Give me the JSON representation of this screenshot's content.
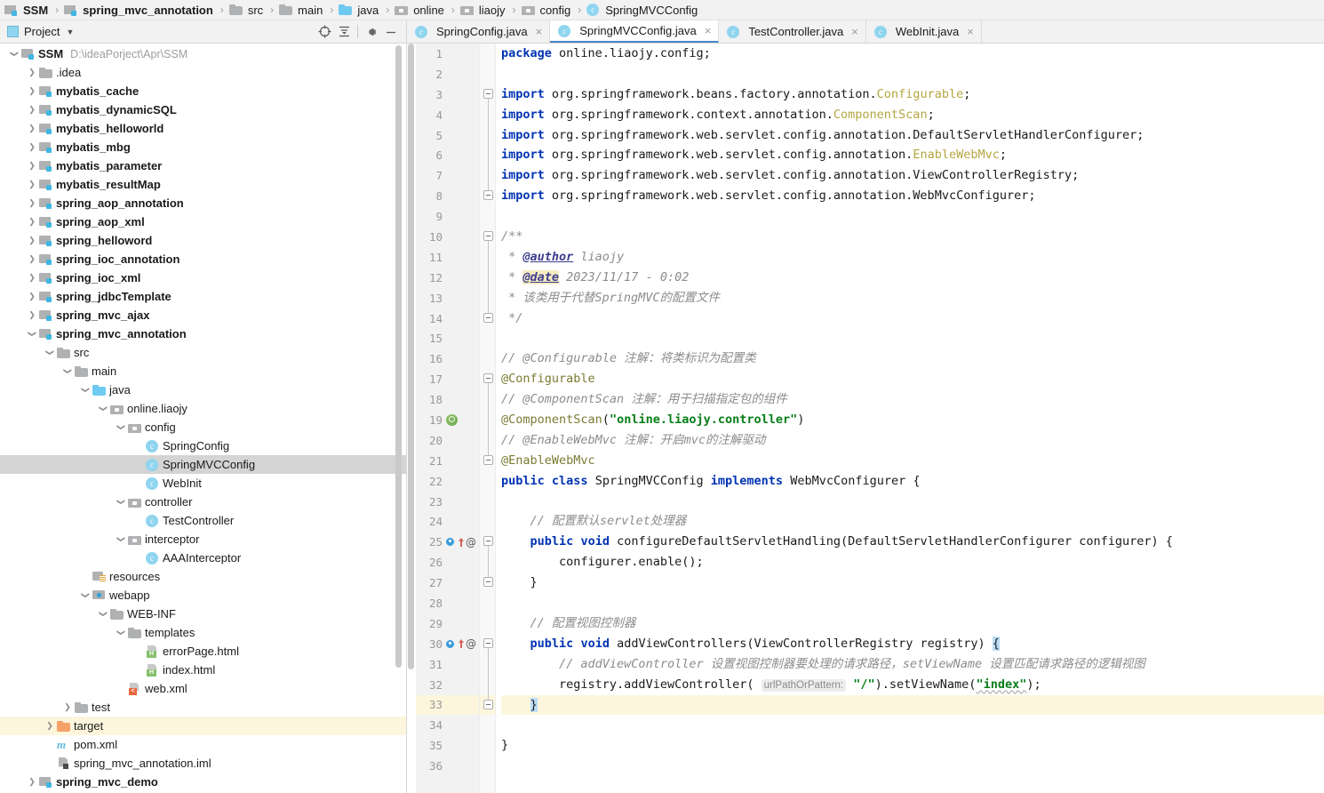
{
  "breadcrumb": {
    "items": [
      {
        "label": "SSM",
        "icon": "project-icon",
        "bold": true,
        "type": "project"
      },
      {
        "label": "spring_mvc_annotation",
        "icon": "module-icon",
        "bold": true,
        "type": "module"
      },
      {
        "label": "src",
        "icon": "folder-icon",
        "bold": false,
        "type": "folder"
      },
      {
        "label": "main",
        "icon": "folder-icon",
        "bold": false,
        "type": "folder"
      },
      {
        "label": "java",
        "icon": "source-folder-icon",
        "bold": false,
        "type": "source"
      },
      {
        "label": "online",
        "icon": "package-icon",
        "bold": false,
        "type": "package"
      },
      {
        "label": "liaojy",
        "icon": "package-icon",
        "bold": false,
        "type": "package"
      },
      {
        "label": "config",
        "icon": "package-icon",
        "bold": false,
        "type": "package"
      },
      {
        "label": "SpringMVCConfig",
        "icon": "class-icon",
        "bold": false,
        "type": "class"
      }
    ],
    "separator": "›"
  },
  "project_panel": {
    "title": "Project",
    "title_icon": "project-view-icon",
    "dropdown_icon": "chevron-down-icon",
    "toolbar": [
      {
        "name": "select-opened-file-icon",
        "glyph": "⊕"
      },
      {
        "name": "collapse-all-icon",
        "glyph": "⤓"
      },
      {
        "name": "settings-gear-icon",
        "glyph": "⚙"
      },
      {
        "name": "hide-panel-icon",
        "glyph": "—"
      }
    ],
    "tree": [
      {
        "indent": 0,
        "arrow": "down",
        "icon": "project-icon",
        "label": "SSM",
        "bold": true,
        "path": "D:\\ideaPorject\\Apr\\SSM"
      },
      {
        "indent": 1,
        "arrow": "right",
        "icon": "folder-icon",
        "label": ".idea",
        "bold": false
      },
      {
        "indent": 1,
        "arrow": "right",
        "icon": "module-icon",
        "label": "mybatis_cache",
        "bold": true
      },
      {
        "indent": 1,
        "arrow": "right",
        "icon": "module-icon",
        "label": "mybatis_dynamicSQL",
        "bold": true
      },
      {
        "indent": 1,
        "arrow": "right",
        "icon": "module-icon",
        "label": "mybatis_helloworld",
        "bold": true
      },
      {
        "indent": 1,
        "arrow": "right",
        "icon": "module-icon",
        "label": "mybatis_mbg",
        "bold": true
      },
      {
        "indent": 1,
        "arrow": "right",
        "icon": "module-icon",
        "label": "mybatis_parameter",
        "bold": true
      },
      {
        "indent": 1,
        "arrow": "right",
        "icon": "module-icon",
        "label": "mybatis_resultMap",
        "bold": true
      },
      {
        "indent": 1,
        "arrow": "right",
        "icon": "module-icon",
        "label": "spring_aop_annotation",
        "bold": true
      },
      {
        "indent": 1,
        "arrow": "right",
        "icon": "module-icon",
        "label": "spring_aop_xml",
        "bold": true
      },
      {
        "indent": 1,
        "arrow": "right",
        "icon": "module-icon",
        "label": "spring_helloword",
        "bold": true
      },
      {
        "indent": 1,
        "arrow": "right",
        "icon": "module-icon",
        "label": "spring_ioc_annotation",
        "bold": true
      },
      {
        "indent": 1,
        "arrow": "right",
        "icon": "module-icon",
        "label": "spring_ioc_xml",
        "bold": true
      },
      {
        "indent": 1,
        "arrow": "right",
        "icon": "module-icon",
        "label": "spring_jdbcTemplate",
        "bold": true
      },
      {
        "indent": 1,
        "arrow": "right",
        "icon": "module-icon",
        "label": "spring_mvc_ajax",
        "bold": true
      },
      {
        "indent": 1,
        "arrow": "down",
        "icon": "module-icon",
        "label": "spring_mvc_annotation",
        "bold": true
      },
      {
        "indent": 2,
        "arrow": "down",
        "icon": "folder-icon",
        "label": "src",
        "bold": false
      },
      {
        "indent": 3,
        "arrow": "down",
        "icon": "folder-icon",
        "label": "main",
        "bold": false
      },
      {
        "indent": 4,
        "arrow": "down",
        "icon": "source-folder-icon",
        "label": "java",
        "bold": false
      },
      {
        "indent": 5,
        "arrow": "down",
        "icon": "package-icon",
        "label": "online.liaojy",
        "bold": false
      },
      {
        "indent": 6,
        "arrow": "down",
        "icon": "package-icon",
        "label": "config",
        "bold": false
      },
      {
        "indent": 7,
        "arrow": "none",
        "icon": "class-icon",
        "label": "SpringConfig",
        "bold": false
      },
      {
        "indent": 7,
        "arrow": "none",
        "icon": "class-icon",
        "label": "SpringMVCConfig",
        "bold": false,
        "state": "selected"
      },
      {
        "indent": 7,
        "arrow": "none",
        "icon": "class-icon",
        "label": "WebInit",
        "bold": false
      },
      {
        "indent": 6,
        "arrow": "down",
        "icon": "package-icon",
        "label": "controller",
        "bold": false
      },
      {
        "indent": 7,
        "arrow": "none",
        "icon": "class-icon",
        "label": "TestController",
        "bold": false
      },
      {
        "indent": 6,
        "arrow": "down",
        "icon": "package-icon",
        "label": "interceptor",
        "bold": false
      },
      {
        "indent": 7,
        "arrow": "none",
        "icon": "class-icon",
        "label": "AAAInterceptor",
        "bold": false
      },
      {
        "indent": 4,
        "arrow": "none",
        "icon": "resources-folder-icon",
        "label": "resources",
        "bold": false
      },
      {
        "indent": 4,
        "arrow": "down",
        "icon": "webapp-folder-icon",
        "label": "webapp",
        "bold": false
      },
      {
        "indent": 5,
        "arrow": "down",
        "icon": "folder-icon",
        "label": "WEB-INF",
        "bold": false
      },
      {
        "indent": 6,
        "arrow": "down",
        "icon": "folder-icon",
        "label": "templates",
        "bold": false
      },
      {
        "indent": 7,
        "arrow": "none",
        "icon": "html-file-icon",
        "label": "errorPage.html",
        "bold": false
      },
      {
        "indent": 7,
        "arrow": "none",
        "icon": "html-file-icon",
        "label": "index.html",
        "bold": false
      },
      {
        "indent": 6,
        "arrow": "none",
        "icon": "xml-file-icon",
        "label": "web.xml",
        "bold": false
      },
      {
        "indent": 3,
        "arrow": "right",
        "icon": "folder-icon",
        "label": "test",
        "bold": false
      },
      {
        "indent": 2,
        "arrow": "right",
        "icon": "target-folder-icon",
        "label": "target",
        "bold": false,
        "state": "highlighted"
      },
      {
        "indent": 2,
        "arrow": "none",
        "icon": "maven-file-icon",
        "label": "pom.xml",
        "bold": false
      },
      {
        "indent": 2,
        "arrow": "none",
        "icon": "iml-file-icon",
        "label": "spring_mvc_annotation.iml",
        "bold": false
      },
      {
        "indent": 1,
        "arrow": "right",
        "icon": "module-icon",
        "label": "spring_mvc_demo",
        "bold": true
      }
    ]
  },
  "editor": {
    "tabs": [
      {
        "label": "SpringConfig.java",
        "icon": "class-icon",
        "active": false,
        "close_glyph": "×"
      },
      {
        "label": "SpringMVCConfig.java",
        "icon": "class-icon",
        "active": true,
        "close_glyph": "×"
      },
      {
        "label": "TestController.java",
        "icon": "class-icon",
        "active": false,
        "close_glyph": "×"
      },
      {
        "label": "WebInit.java",
        "icon": "class-icon",
        "active": false,
        "close_glyph": "×"
      }
    ],
    "caret_line": 33,
    "lines": [
      {
        "n": 1,
        "gutter": [],
        "fold": "",
        "html": "<span class=\"kw\">package</span> <span class=\"plain\">online.liaojy.config;</span>"
      },
      {
        "n": 2,
        "gutter": [],
        "fold": "",
        "html": ""
      },
      {
        "n": 3,
        "gutter": [],
        "fold": "top",
        "html": "<span class=\"kw\">import</span> <span class=\"plain\">org.springframework.beans.factory.annotation.</span><span class=\"cls\">Configurable</span><span class=\"plain\">;</span>"
      },
      {
        "n": 4,
        "gutter": [],
        "fold": "line",
        "html": "<span class=\"kw\">import</span> <span class=\"plain\">org.springframework.context.annotation.</span><span class=\"cls\">ComponentScan</span><span class=\"plain\">;</span>"
      },
      {
        "n": 5,
        "gutter": [],
        "fold": "line",
        "html": "<span class=\"kw\">import</span> <span class=\"plain\">org.springframework.web.servlet.config.annotation.DefaultServletHandlerConfigurer;</span>"
      },
      {
        "n": 6,
        "gutter": [],
        "fold": "line",
        "html": "<span class=\"kw\">import</span> <span class=\"plain\">org.springframework.web.servlet.config.annotation.</span><span class=\"cls\">EnableWebMvc</span><span class=\"plain\">;</span>"
      },
      {
        "n": 7,
        "gutter": [],
        "fold": "line",
        "html": "<span class=\"kw\">import</span> <span class=\"plain\">org.springframework.web.servlet.config.annotation.ViewControllerRegistry;</span>"
      },
      {
        "n": 8,
        "gutter": [],
        "fold": "bot",
        "html": "<span class=\"kw\">import</span> <span class=\"plain\">org.springframework.web.servlet.config.annotation.WebMvcConfigurer;</span>"
      },
      {
        "n": 9,
        "gutter": [],
        "fold": "",
        "html": ""
      },
      {
        "n": 10,
        "gutter": [],
        "fold": "top",
        "html": "<span class=\"jdoc\">/**</span>"
      },
      {
        "n": 11,
        "gutter": [],
        "fold": "line",
        "html": "<span class=\"jdoc\"> * </span><span class=\"jtag\">@author</span><span class=\"jdoc\"> liaojy</span>"
      },
      {
        "n": 12,
        "gutter": [],
        "fold": "line",
        "html": "<span class=\"jdoc\"> * </span><span class=\"jtag jtag-hl\">@date</span><span class=\"jdoc\"> 2023/11/17 - 0:02</span>"
      },
      {
        "n": 13,
        "gutter": [],
        "fold": "line",
        "html": "<span class=\"jdoc\"> * 该类用于代替SpringMVC的配置文件</span>"
      },
      {
        "n": 14,
        "gutter": [],
        "fold": "bot",
        "html": "<span class=\"jdoc\"> */</span>"
      },
      {
        "n": 15,
        "gutter": [],
        "fold": "",
        "html": ""
      },
      {
        "n": 16,
        "gutter": [],
        "fold": "",
        "html": "<span class=\"cmt\">// @Configurable 注解：将类标识为配置类</span>"
      },
      {
        "n": 17,
        "gutter": [],
        "fold": "top",
        "html": "<span class=\"ann\">@Configurable</span>"
      },
      {
        "n": 18,
        "gutter": [],
        "fold": "line",
        "html": "<span class=\"cmt\">// @ComponentScan 注解：用于扫描指定包的组件</span>"
      },
      {
        "n": 19,
        "gutter": [
          "bean"
        ],
        "fold": "line",
        "html": "<span class=\"ann\">@ComponentScan</span><span class=\"plain\">(</span><span class=\"str\">\"online.liaojy.controller\"</span><span class=\"plain\">)</span>"
      },
      {
        "n": 20,
        "gutter": [],
        "fold": "line",
        "html": "<span class=\"cmt\">// @EnableWebMvc 注解：开启mvc的注解驱动</span>"
      },
      {
        "n": 21,
        "gutter": [],
        "fold": "bot",
        "html": "<span class=\"ann\">@EnableWebMvc</span>"
      },
      {
        "n": 22,
        "gutter": [],
        "fold": "",
        "html": "<span class=\"kw\">public</span> <span class=\"kw\">class</span> <span class=\"plain\">SpringMVCConfig</span> <span class=\"kw\">implements</span> <span class=\"plain\">WebMvcConfigurer {</span>"
      },
      {
        "n": 23,
        "gutter": [],
        "fold": "",
        "html": ""
      },
      {
        "n": 24,
        "gutter": [],
        "fold": "",
        "html": "    <span class=\"cmt\">// 配置默认servlet处理器</span>"
      },
      {
        "n": 25,
        "gutter": [
          "override",
          "arrow-up",
          "at"
        ],
        "fold": "top",
        "html": "    <span class=\"kw\">public</span> <span class=\"kw\">void</span> <span class=\"plain\">configureDefaultServletHandling(DefaultServletHandlerConfigurer configurer) {</span>"
      },
      {
        "n": 26,
        "gutter": [],
        "fold": "line",
        "html": "        <span class=\"plain\">configurer.enable();</span>"
      },
      {
        "n": 27,
        "gutter": [],
        "fold": "bot",
        "html": "    <span class=\"plain\">}</span>"
      },
      {
        "n": 28,
        "gutter": [],
        "fold": "",
        "html": ""
      },
      {
        "n": 29,
        "gutter": [],
        "fold": "",
        "html": "    <span class=\"cmt\">// 配置视图控制器</span>"
      },
      {
        "n": 30,
        "gutter": [
          "override",
          "arrow-up",
          "at"
        ],
        "fold": "top",
        "html": "    <span class=\"kw\">public</span> <span class=\"kw\">void</span> <span class=\"plain\">addViewControllers(ViewControllerRegistry registry) </span><span class=\"brace-hl\">{</span>"
      },
      {
        "n": 31,
        "gutter": [],
        "fold": "line",
        "html": "        <span class=\"cmt\">// addViewController 设置视图控制器要处理的请求路径，setViewName 设置匹配请求路径的逻辑视图</span>"
      },
      {
        "n": 32,
        "gutter": [],
        "fold": "line",
        "html": "        <span class=\"plain\">registry.addViewController(</span> <span class=\"phint\">urlPathOrPattern:</span> <span class=\"str\">\"/\"</span><span class=\"plain\">).setViewName(</span><span class=\"str squiggle\">\"index\"</span><span class=\"plain\">);</span>"
      },
      {
        "n": 33,
        "gutter": [],
        "fold": "bot",
        "html": "    <span class=\"brace-hl\">}</span>"
      },
      {
        "n": 34,
        "gutter": [],
        "fold": "",
        "html": ""
      },
      {
        "n": 35,
        "gutter": [],
        "fold": "",
        "html": "<span class=\"plain\">}</span>"
      },
      {
        "n": 36,
        "gutter": [],
        "fold": "",
        "html": ""
      }
    ]
  },
  "colors": {
    "accent_tab": "#4a86c8",
    "keyword": "#0033b3",
    "string": "#067d17",
    "comment": "#8c8c8c",
    "annotation": "#7a7a33",
    "unused_class": "#b5a642",
    "caret_line_bg": "#fdf6dd",
    "selection_bg": "#d4d4d4",
    "panel_bg": "#f2f2f2"
  }
}
